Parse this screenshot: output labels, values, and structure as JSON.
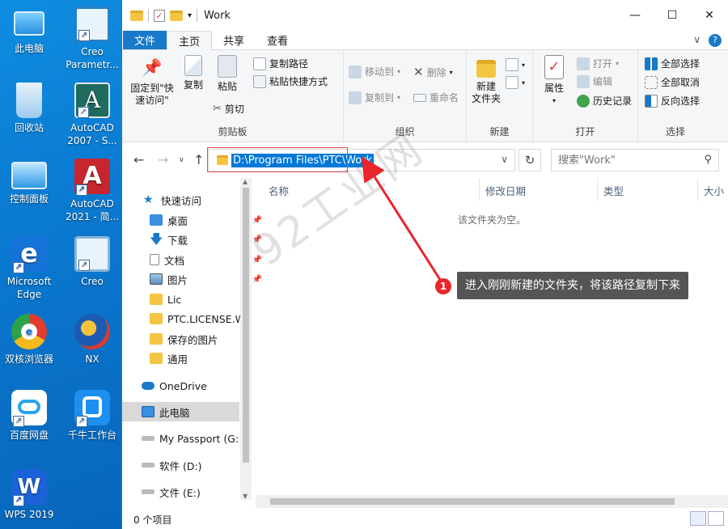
{
  "desktop": {
    "icons": [
      {
        "label": "此电脑",
        "icon": "computer-icon"
      },
      {
        "label": "Creo Parametr...",
        "icon": "creo-parametric-icon"
      },
      {
        "label": "回收站",
        "icon": "recycle-bin-icon"
      },
      {
        "label": "AutoCAD 2007 - S...",
        "icon": "autocad-2007-icon"
      },
      {
        "label": "控制面板",
        "icon": "control-panel-icon"
      },
      {
        "label": "AutoCAD 2021 - 简...",
        "icon": "autocad-2021-icon"
      },
      {
        "label": "Microsoft Edge",
        "icon": "edge-icon"
      },
      {
        "label": "Creo",
        "icon": "creo-icon"
      },
      {
        "label": "双核浏览器",
        "icon": "dual-core-browser-icon"
      },
      {
        "label": "NX",
        "icon": "nx-icon"
      },
      {
        "label": "百度网盘",
        "icon": "baidu-netdisk-icon"
      },
      {
        "label": "千牛工作台",
        "icon": "qianniu-icon"
      },
      {
        "label": "WPS 2019",
        "icon": "wps-icon"
      }
    ]
  },
  "window": {
    "title": "Work",
    "controls": {
      "minimize": "—",
      "maximize": "☐",
      "close": "✕"
    }
  },
  "ribbon_tabs": {
    "file": "文件",
    "home": "主页",
    "share": "共享",
    "view": "查看"
  },
  "ribbon": {
    "clipboard": {
      "pin": "固定到\"快\n速访问\"",
      "copy": "复制",
      "paste": "粘贴",
      "copy_path": "复制路径",
      "paste_shortcut": "粘贴快捷方式",
      "cut": "剪切",
      "label": "剪贴板"
    },
    "organize": {
      "move_to": "移动到",
      "copy_to": "复制到",
      "delete": "删除",
      "rename": "重命名",
      "label": "组织"
    },
    "new": {
      "new_folder": "新建\n文件夹",
      "label": "新建"
    },
    "open": {
      "properties": "属性",
      "open": "打开",
      "edit": "编辑",
      "history": "历史记录",
      "label": "打开"
    },
    "select": {
      "select_all": "全部选择",
      "select_none": "全部取消",
      "invert": "反向选择",
      "label": "选择"
    }
  },
  "address": {
    "path": "D:\\Program Files\\PTC\\Work",
    "search_placeholder": "搜索\"Work\""
  },
  "nav": {
    "quick_access": "快速访问",
    "items": [
      {
        "label": "桌面",
        "pinned": true
      },
      {
        "label": "下载",
        "pinned": true
      },
      {
        "label": "文档",
        "pinned": true
      },
      {
        "label": "图片",
        "pinned": true
      },
      {
        "label": "Lic",
        "pinned": false
      },
      {
        "label": "PTC.LICENSE.W",
        "pinned": false
      },
      {
        "label": "保存的图片",
        "pinned": false
      },
      {
        "label": "通用",
        "pinned": false
      }
    ],
    "onedrive": "OneDrive",
    "this_pc": "此电脑",
    "drives": [
      {
        "label": "My Passport (G:"
      },
      {
        "label": "软件 (D:)"
      },
      {
        "label": "文件 (E:)"
      }
    ],
    "pin_glyph": "📌"
  },
  "content": {
    "columns": {
      "name": "名称",
      "modified": "修改日期",
      "type": "类型",
      "size": "大小"
    },
    "empty_message": "该文件夹为空。"
  },
  "status": {
    "item_count": "0 个项目"
  },
  "annotation": {
    "step_number": "1",
    "text": "进入刚刚新建的文件夹，将该路径复制下来",
    "watermark": "92工业网",
    "colors": {
      "highlight": "#e84a5f",
      "badge": "#e8262b",
      "callout_bg": "#555555"
    }
  }
}
